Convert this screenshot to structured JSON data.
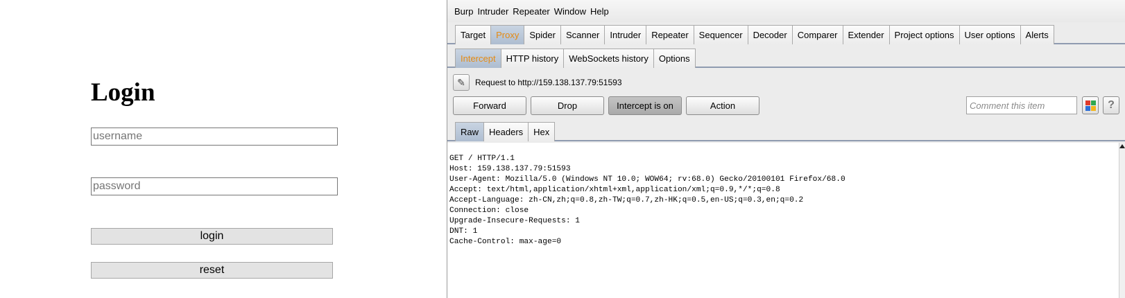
{
  "login": {
    "title": "Login",
    "username_placeholder": "username",
    "password_placeholder": "password",
    "login_label": "login",
    "reset_label": "reset"
  },
  "burp": {
    "menu": [
      "Burp",
      "Intruder",
      "Repeater",
      "Window",
      "Help"
    ],
    "main_tabs": [
      "Target",
      "Proxy",
      "Spider",
      "Scanner",
      "Intruder",
      "Repeater",
      "Sequencer",
      "Decoder",
      "Comparer",
      "Extender",
      "Project options",
      "User options",
      "Alerts"
    ],
    "main_active": "Proxy",
    "sub_tabs": [
      "Intercept",
      "HTTP history",
      "WebSockets history",
      "Options"
    ],
    "sub_active": "Intercept",
    "request_label": "Request to http://159.138.137.79:51593",
    "buttons": {
      "forward": "Forward",
      "drop": "Drop",
      "intercept": "Intercept is on",
      "action": "Action"
    },
    "comment_placeholder": "Comment this item",
    "help_glyph": "?",
    "view_tabs": [
      "Raw",
      "Headers",
      "Hex"
    ],
    "view_active": "Raw",
    "request_lines": [
      "GET / HTTP/1.1",
      "Host: 159.138.137.79:51593",
      "User-Agent: Mozilla/5.0 (Windows NT 10.0; WOW64; rv:68.0) Gecko/20100101 Firefox/68.0",
      "Accept: text/html,application/xhtml+xml,application/xml;q=0.9,*/*;q=0.8",
      "Accept-Language: zh-CN,zh;q=0.8,zh-TW;q=0.7,zh-HK;q=0.5,en-US;q=0.3,en;q=0.2",
      "Connection: close",
      "Upgrade-Insecure-Requests: 1",
      "DNT: 1",
      "Cache-Control: max-age=0"
    ]
  },
  "colors": {
    "active_tab_text": "#e58a12",
    "color_squares": [
      "#e03b2b",
      "#2fa84f",
      "#2d6fd6",
      "#f2b51c"
    ]
  }
}
